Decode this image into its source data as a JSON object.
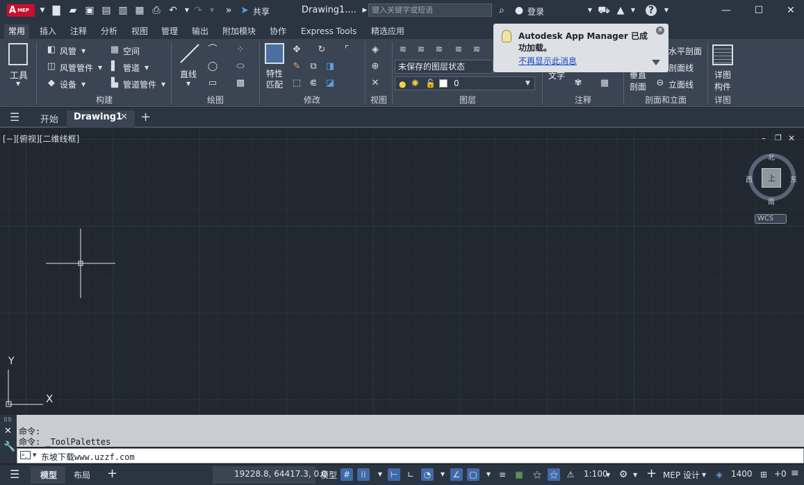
{
  "titlebar": {
    "logo_letter": "A",
    "logo_suffix": "MEP",
    "share_label": "共享",
    "doc_title": "Drawing1....",
    "search_placeholder": "键入关键字或短语",
    "login_label": "登录"
  },
  "tabs": [
    "常用",
    "插入",
    "注释",
    "分析",
    "视图",
    "管理",
    "输出",
    "附加模块",
    "协作",
    "Express Tools",
    "精选应用"
  ],
  "ribbon": {
    "tool_label": "工具",
    "build": {
      "items": [
        "风管",
        "风管管件",
        "设备",
        "空间",
        "管道",
        "管道管件"
      ],
      "label": "构建"
    },
    "draw": {
      "line_label": "直线",
      "label": "绘图"
    },
    "modify": {
      "props_label": "特性\n匹配",
      "props_top": "特性",
      "props_bottom": "匹配",
      "label": "修改"
    },
    "view": {
      "label": "视图"
    },
    "layer": {
      "state": "未保存的图层状态",
      "current": "0",
      "label": "图层"
    },
    "annotate": {
      "text_label": "文字",
      "label": "注释"
    },
    "section": {
      "vertical_top": "垂直",
      "vertical_bottom": "剖面",
      "items": [
        "水平剖面",
        "剖面线",
        "立面线"
      ],
      "label": "剖面和立面"
    },
    "detail": {
      "top": "详图",
      "bottom": "构件",
      "label": "详图"
    }
  },
  "notification": {
    "title": "Autodesk App Manager 已成功加载。",
    "link": "不再显示此消息"
  },
  "doctabs": {
    "start": "开始",
    "active": "Drawing1"
  },
  "canvas": {
    "view_label": "[−][俯视][二维线框]"
  },
  "viewcube": {
    "north": "北",
    "south": "南",
    "east": "东",
    "west": "西",
    "top_face": "上",
    "wcs": "WCS"
  },
  "ucs": {
    "y": "Y",
    "x": "X"
  },
  "command": {
    "lines": [
      "命令:",
      "命令: _ToolPalettes"
    ],
    "input": "东坡下载www.uzzf.com"
  },
  "status": {
    "model_tab": "模型",
    "layout_tab": "布局",
    "coords": "19228.8, 64417.3, 0.0",
    "model_label": "模型",
    "scale": "1:100",
    "workspace": "MEP 设计",
    "elevation": "1400",
    "plus": "+0"
  }
}
